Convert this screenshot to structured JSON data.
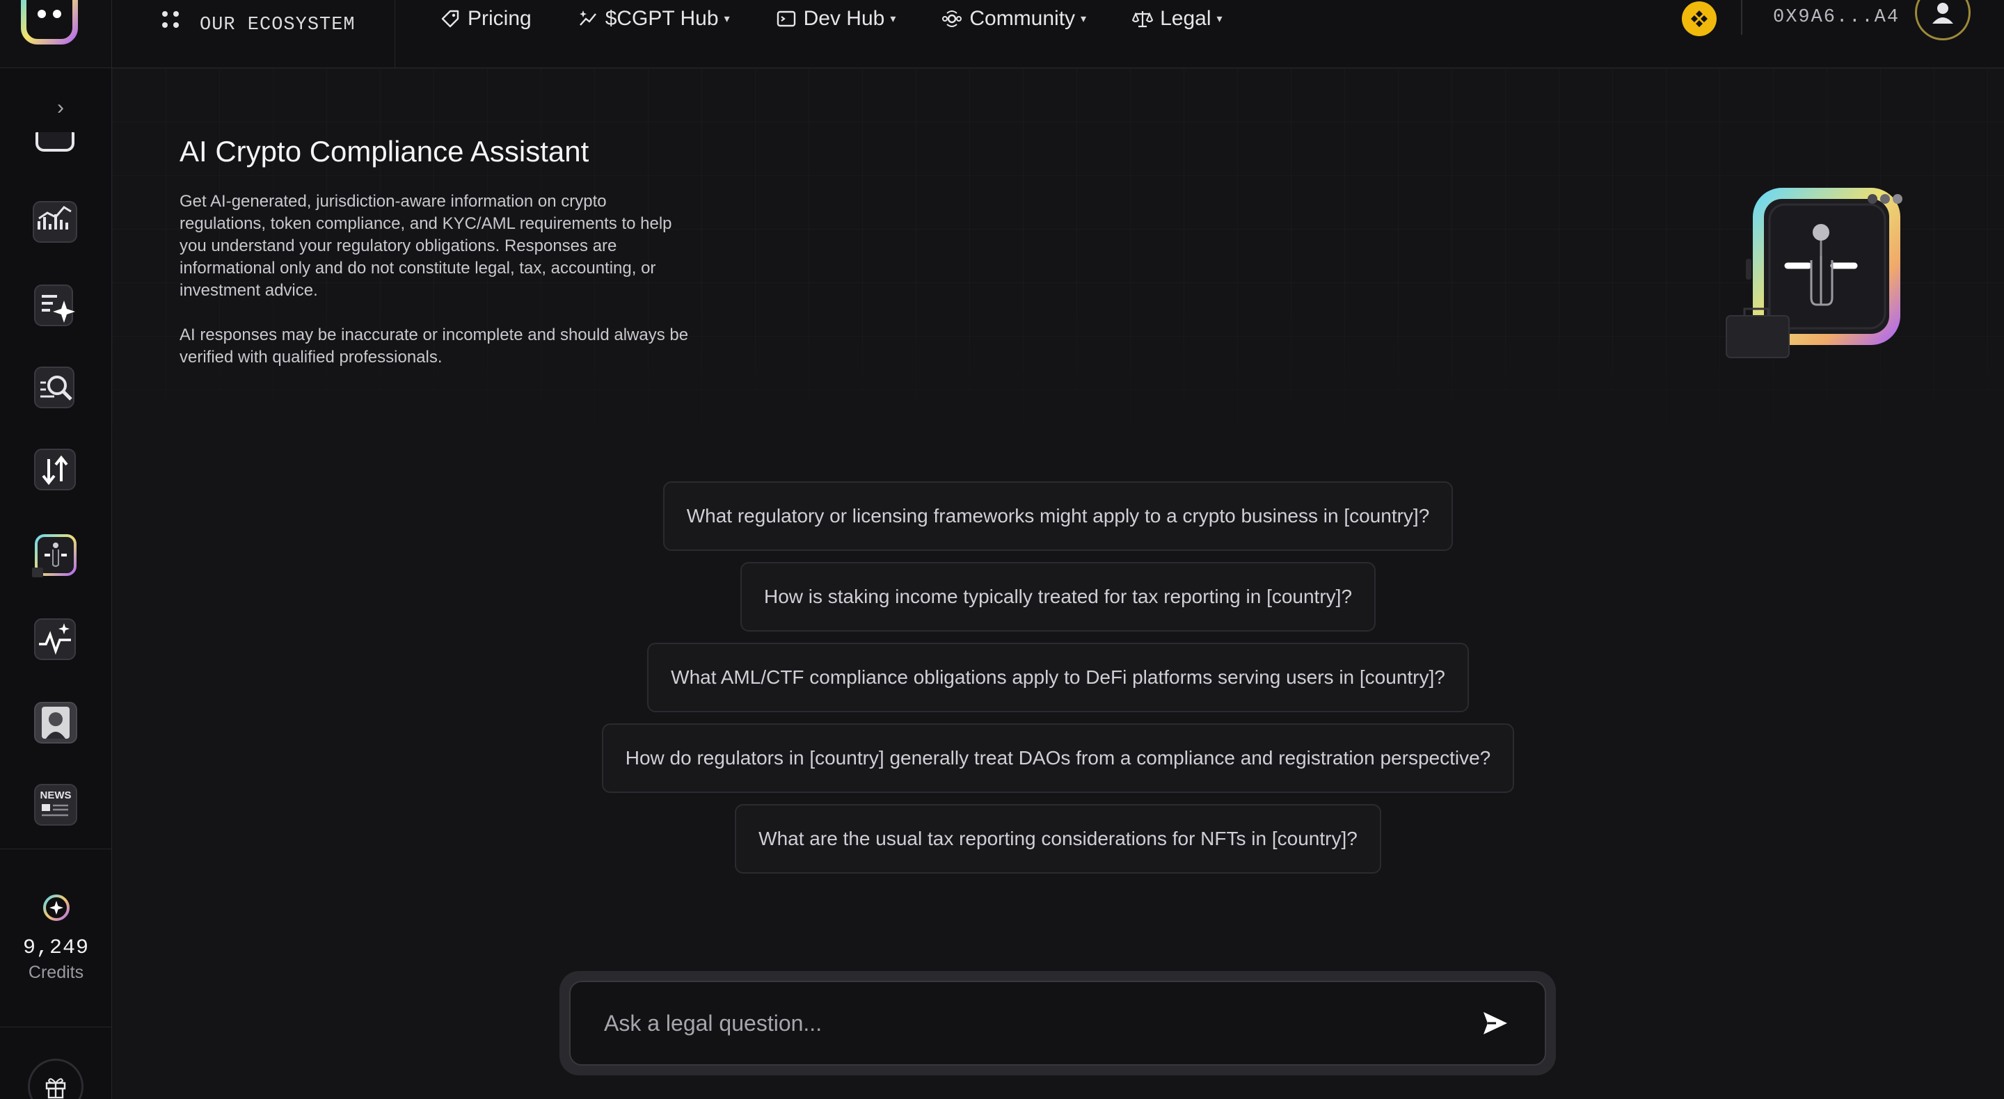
{
  "topbar": {
    "ecosystem_label": "OUR ECOSYSTEM",
    "nav": [
      {
        "label": "Pricing",
        "icon": "tag-icon",
        "has_caret": false
      },
      {
        "label": "$CGPT Hub",
        "icon": "sparkle-chart-icon",
        "has_caret": true
      },
      {
        "label": "Dev Hub",
        "icon": "terminal-icon",
        "has_caret": true
      },
      {
        "label": "Community",
        "icon": "community-icon",
        "has_caret": true
      },
      {
        "label": "Legal",
        "icon": "scales-icon",
        "has_caret": true
      }
    ],
    "caret_glyph": "▾",
    "wallet_address": "0X9A6...A4",
    "bnb_color": "#f0b90b"
  },
  "sidebar": {
    "toggle_glyph": "›",
    "tools": [
      "partial-tool-icon",
      "chart-tool-icon",
      "doc-sparkle-tool-icon",
      "search-tool-icon",
      "swap-arrows-tool-icon",
      "compliance-robot-tool-icon",
      "pulse-sparkle-tool-icon",
      "portrait-tool-icon",
      "news-tool-icon"
    ],
    "news_text": "NEWS",
    "credits_value": "9,249",
    "credits_label": "Credits"
  },
  "main": {
    "title": "AI Crypto Compliance Assistant",
    "description": "Get AI-generated, jurisdiction-aware information on crypto regulations, token compliance, and KYC/AML requirements to help you understand your regulatory obligations. Responses are informational only and do not constitute legal, tax, accounting, or investment advice.",
    "disclaimer": "AI responses may be inaccurate or incomplete and should always be verified with qualified professionals.",
    "suggestions": [
      "What regulatory or licensing frameworks might apply to a crypto business in [country]?",
      "How is staking income typically treated for tax reporting in [country]?",
      "What AML/CTF compliance obligations apply to DeFi platforms serving users in [country]?",
      "How do regulators in [country] generally treat DAOs from a compliance and registration perspective?",
      "What are the usual tax reporting considerations for NFTs in [country]?"
    ],
    "input_placeholder": "Ask a legal question..."
  }
}
